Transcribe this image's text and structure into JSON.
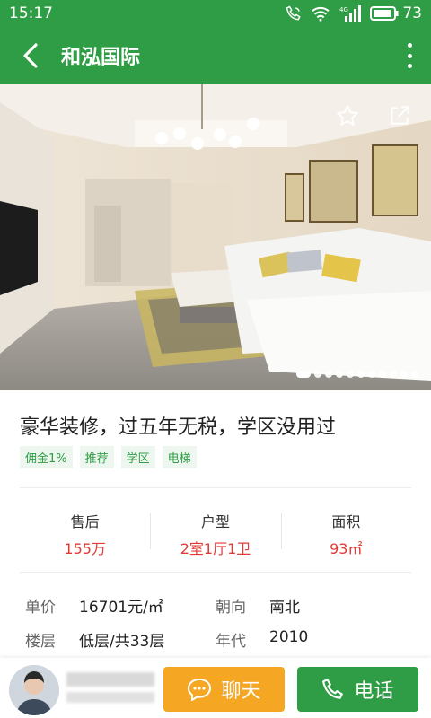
{
  "status_bar": {
    "time": "15:17",
    "battery_percent": "73",
    "icons": [
      "wifi-call-icon",
      "wifi-icon",
      "signal-4g-icon",
      "battery-icon"
    ]
  },
  "app_bar": {
    "title": "和泓国际",
    "back_icon": "chevron-left-icon",
    "more_icon": "more-vertical-icon"
  },
  "gallery": {
    "actions": [
      "star-icon",
      "share-icon"
    ],
    "page_count": 11,
    "active_index": 0
  },
  "listing": {
    "title": "豪华装修，过五年无税，学区没用过",
    "tags": [
      "佣金1%",
      "推荐",
      "学区",
      "电梯"
    ]
  },
  "stats": [
    {
      "label": "售后",
      "value": "155万"
    },
    {
      "label": "户型",
      "value": "2室1厅1卫"
    },
    {
      "label": "面积",
      "value": "93㎡"
    }
  ],
  "details": [
    {
      "l_label": "单价",
      "l_value": "16701元/㎡",
      "r_label": "朝向",
      "r_value": "南北"
    },
    {
      "l_label": "楼层",
      "l_value": "低层/共33层",
      "r_label": "年代",
      "r_value": "2010"
    }
  ],
  "bottom_bar": {
    "chat_label": "聊天",
    "call_label": "电话"
  },
  "colors": {
    "brand_green": "#2f9d45",
    "accent_orange": "#f5a623",
    "price_red": "#e23a36"
  }
}
